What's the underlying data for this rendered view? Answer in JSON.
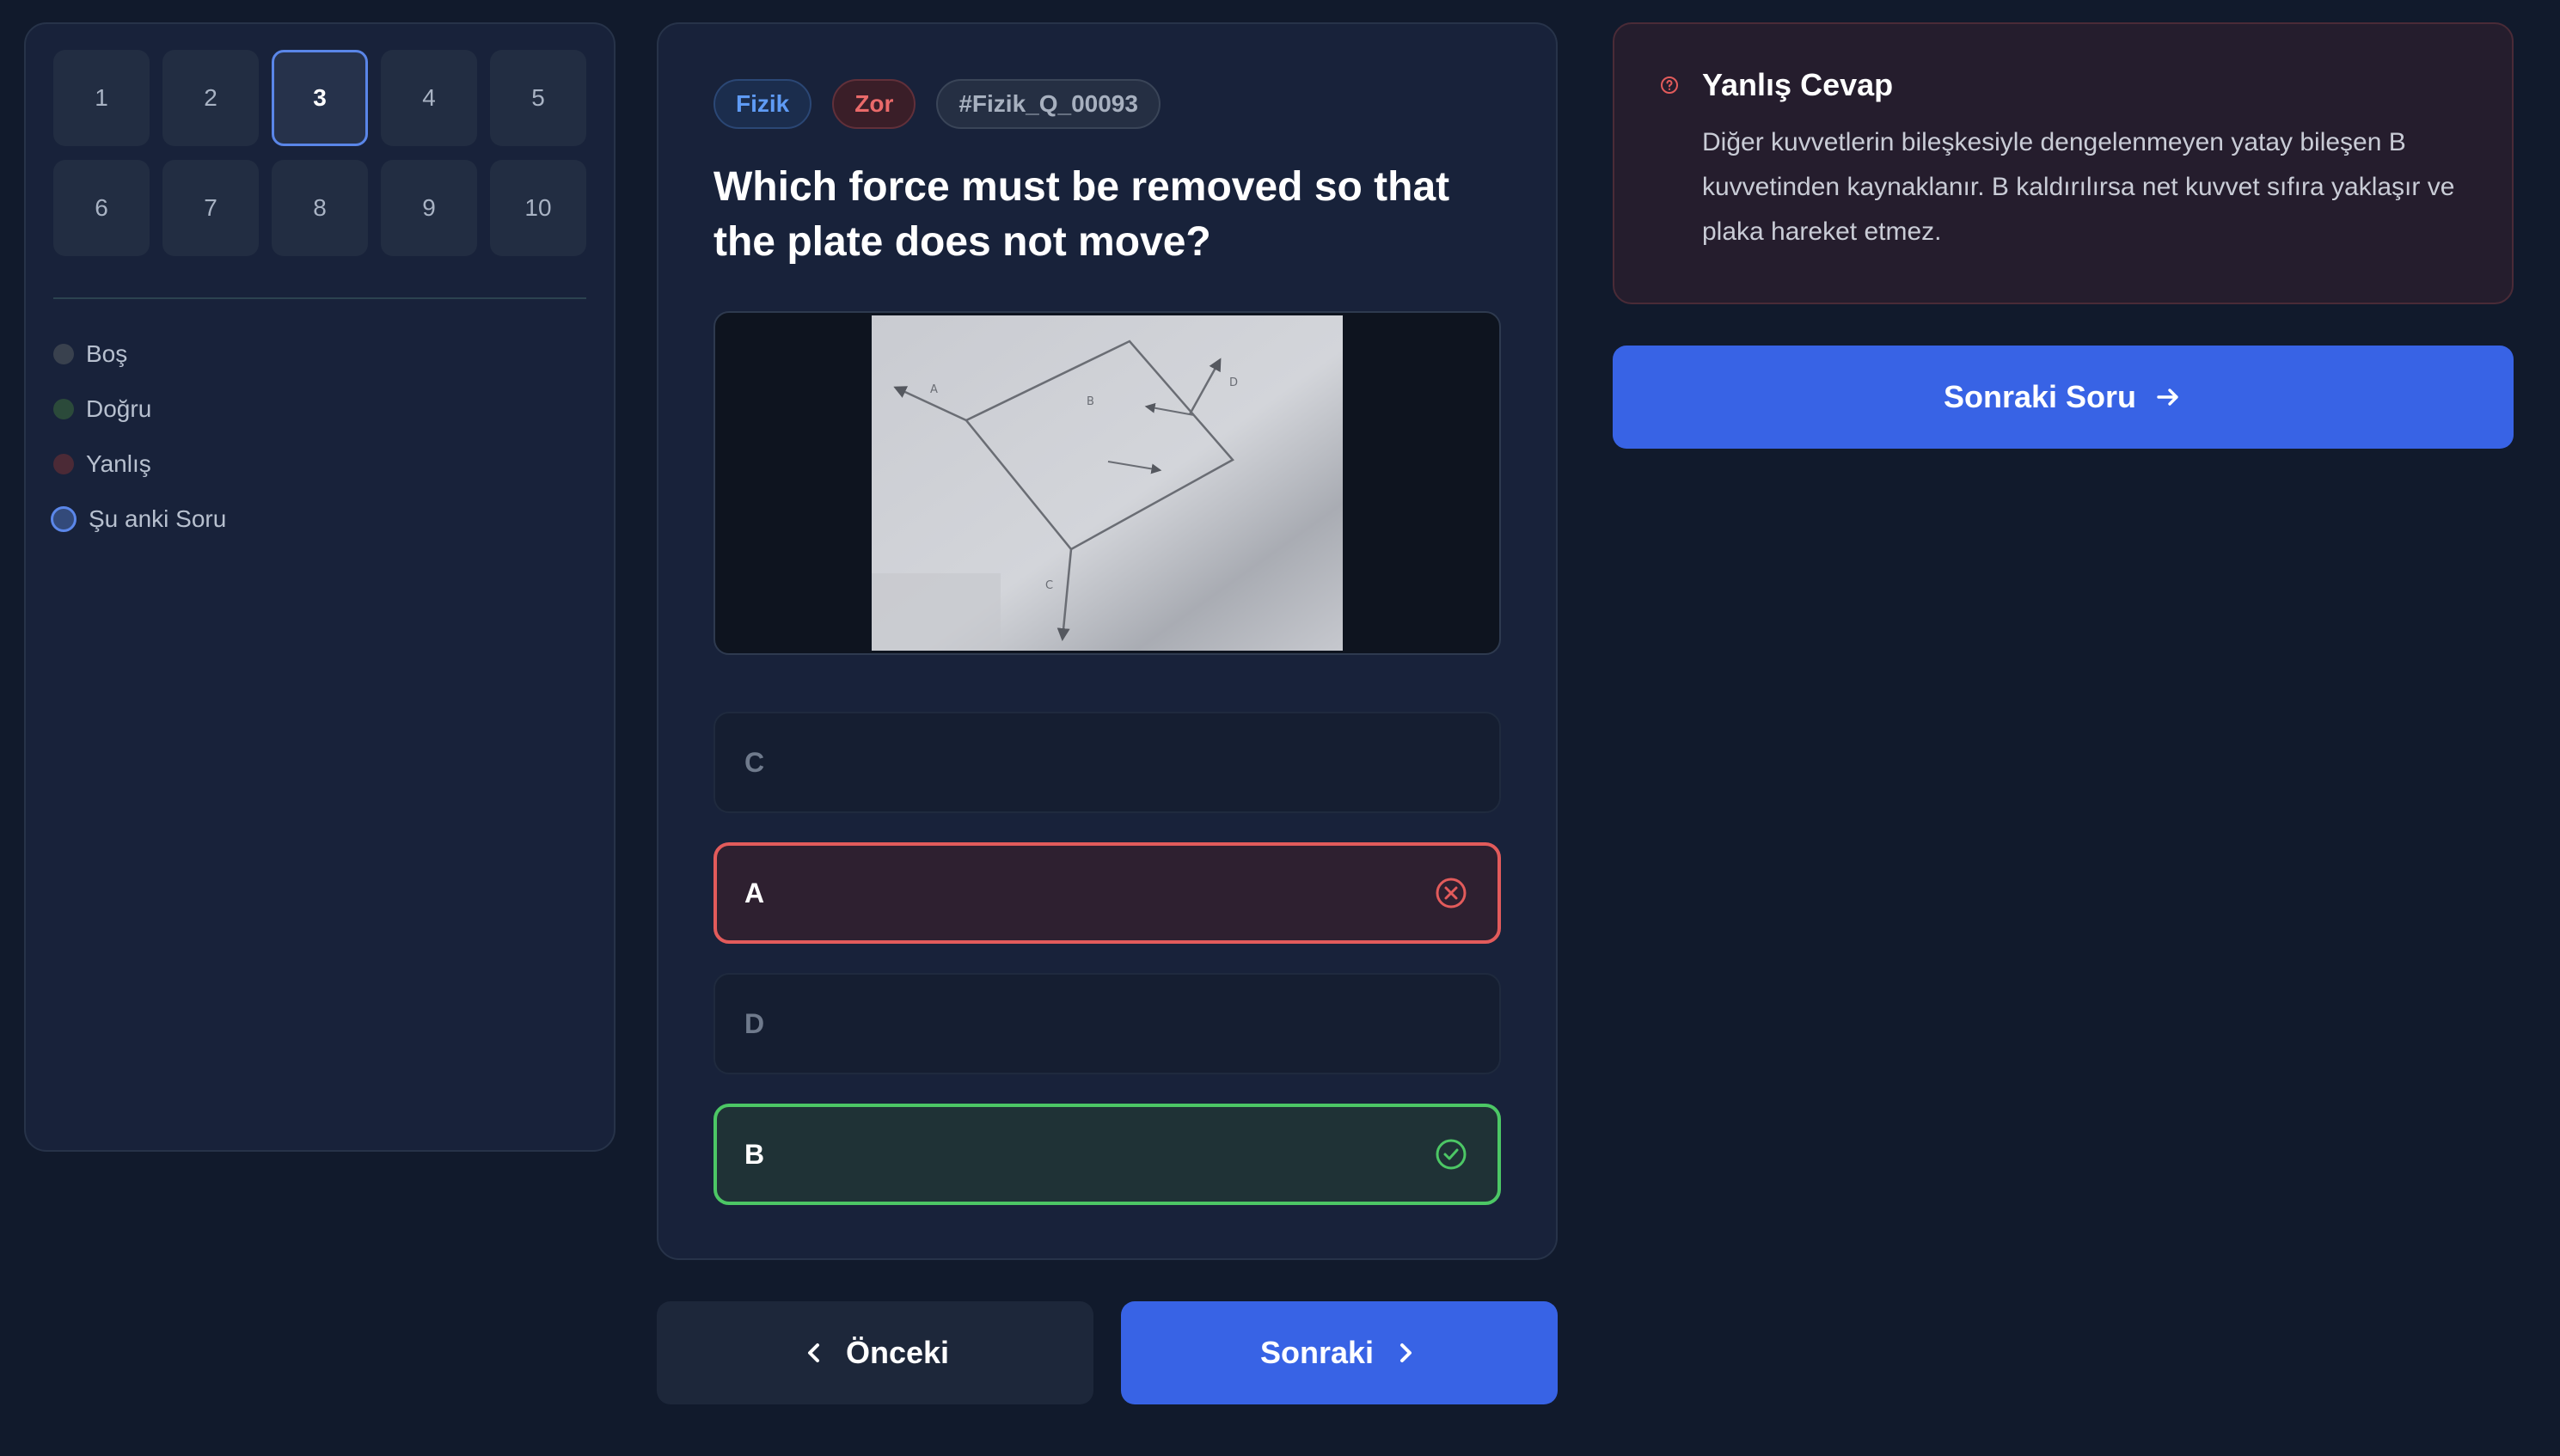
{
  "navigator": {
    "questions": [
      "1",
      "2",
      "3",
      "4",
      "5",
      "6",
      "7",
      "8",
      "9",
      "10"
    ],
    "current": "3",
    "legend": {
      "empty": "Boş",
      "correct": "Doğru",
      "wrong": "Yanlış",
      "current": "Şu anki Soru"
    }
  },
  "question": {
    "subject_tag": "Fizik",
    "difficulty_tag": "Zor",
    "id_tag": "#Fizik_Q_00093",
    "text": "Which force must be removed so that the plate does not move?",
    "figure_labels": [
      "A",
      "B",
      "D",
      "C"
    ],
    "options": [
      {
        "label": "C",
        "state": "neutral"
      },
      {
        "label": "A",
        "state": "wrong"
      },
      {
        "label": "D",
        "state": "neutral"
      },
      {
        "label": "B",
        "state": "correct"
      }
    ]
  },
  "feedback": {
    "title": "Yanlış Cevap",
    "body": "Diğer kuvvetlerin bileşkesiyle dengelenmeyen yatay bileşen B kuvvetinden kaynaklanır. B kaldırılırsa net kuvvet sıfıra yaklaşır ve plaka hareket etmez.",
    "next_question_label": "Sonraki Soru"
  },
  "footer": {
    "prev_label": "Önceki",
    "next_label": "Sonraki"
  },
  "colors": {
    "accent": "#3863e5",
    "wrong": "#e25b5b",
    "correct": "#4cc765",
    "background": "#111a2c"
  }
}
